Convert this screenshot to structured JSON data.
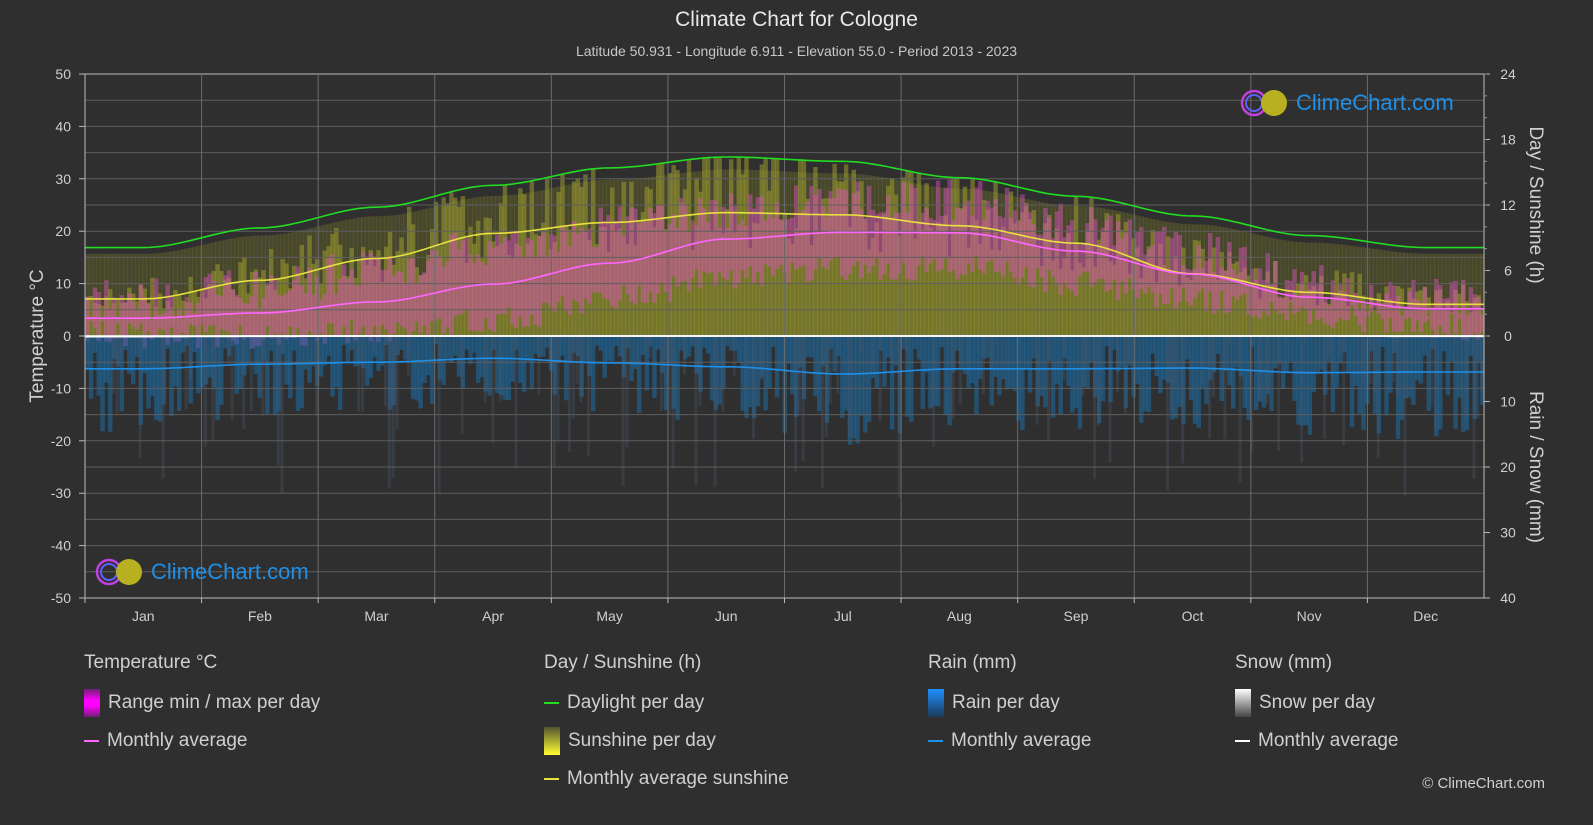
{
  "header": {
    "title": "Climate Chart for Cologne",
    "subtitle": "Latitude 50.931 - Longitude 6.911 - Elevation 55.0 - Period 2013 - 2023"
  },
  "logo": {
    "text": "ClimeChart.com"
  },
  "copyright": "© ClimeChart.com",
  "legend": {
    "temperature": {
      "title": "Temperature °C",
      "range": "Range min / max per day",
      "avg": "Monthly average"
    },
    "sunshine": {
      "title": "Day / Sunshine (h)",
      "daylight": "Daylight per day",
      "sunshine": "Sunshine per day",
      "avg": "Monthly average sunshine"
    },
    "rain": {
      "title": "Rain (mm)",
      "per_day": "Rain per day",
      "avg": "Monthly average"
    },
    "snow": {
      "title": "Snow (mm)",
      "per_day": "Snow per day",
      "avg": "Monthly average"
    }
  },
  "colors": {
    "temperature_avg": "#ff66ff",
    "temperature_range": "#e040e0",
    "daylight": "#22dd22",
    "sunshine_avg": "#e8e040",
    "sunshine_bar": "#9a9a30",
    "rain_avg": "#1e90e8",
    "rain_bar": "#1e6ea8",
    "snow_avg": "#ffffff",
    "background": "#2f2f2f",
    "grid": "#5a5a5a"
  },
  "chart_data": {
    "type": "line",
    "title": "Climate Chart for Cologne",
    "categories": [
      "Jan",
      "Feb",
      "Mar",
      "Apr",
      "May",
      "Jun",
      "Jul",
      "Aug",
      "Sep",
      "Oct",
      "Nov",
      "Dec"
    ],
    "left_axis": {
      "label": "Temperature °C",
      "range": [
        -50,
        50
      ],
      "ticks": [
        "50",
        "40",
        "30",
        "20",
        "10",
        "0",
        "-10",
        "-20",
        "-30",
        "-40",
        "-50"
      ]
    },
    "right_axis_top": {
      "label": "Day / Sunshine (h)",
      "range": [
        0,
        24
      ],
      "ticks": [
        "24",
        "18",
        "12",
        "6",
        "0"
      ]
    },
    "right_axis_bottom": {
      "label": "Rain / Snow (mm)",
      "range": [
        0,
        40
      ],
      "ticks": [
        "10",
        "20",
        "30",
        "40"
      ]
    },
    "grid": true,
    "series": [
      {
        "name": "Temperature monthly average (°C)",
        "axis": "temperature",
        "values": [
          3.4,
          4.4,
          6.5,
          9.9,
          13.9,
          18.5,
          19.8,
          19.7,
          16.2,
          11.8,
          7.4,
          5.2
        ]
      },
      {
        "name": "Daylight per day (h)",
        "axis": "hours",
        "values": [
          8.1,
          9.9,
          11.8,
          13.8,
          15.4,
          16.4,
          16.0,
          14.5,
          12.8,
          11.0,
          9.2,
          8.1
        ]
      },
      {
        "name": "Monthly average sunshine (h)",
        "axis": "hours",
        "values": [
          3.4,
          5.1,
          7.1,
          9.4,
          10.4,
          11.3,
          11.1,
          10.1,
          8.5,
          5.7,
          4.0,
          2.9
        ]
      },
      {
        "name": "Rain monthly average (mm)",
        "axis": "precip",
        "values": [
          5.0,
          4.3,
          4.0,
          3.4,
          4.1,
          4.7,
          5.8,
          5.0,
          5.0,
          4.9,
          5.6,
          5.5
        ]
      },
      {
        "name": "Snow monthly average (mm)",
        "axis": "precip",
        "values": [
          0.1,
          0.05,
          0,
          0,
          0,
          0,
          0,
          0,
          0,
          0,
          0,
          0.05
        ]
      }
    ],
    "ranges": {
      "temperature_max_approx": [
        7,
        9,
        13,
        17,
        21,
        24,
        26,
        26,
        21,
        16,
        10,
        7
      ],
      "temperature_min_approx": [
        0,
        0,
        1,
        3,
        7,
        11,
        13,
        13,
        10,
        7,
        4,
        2
      ]
    }
  }
}
